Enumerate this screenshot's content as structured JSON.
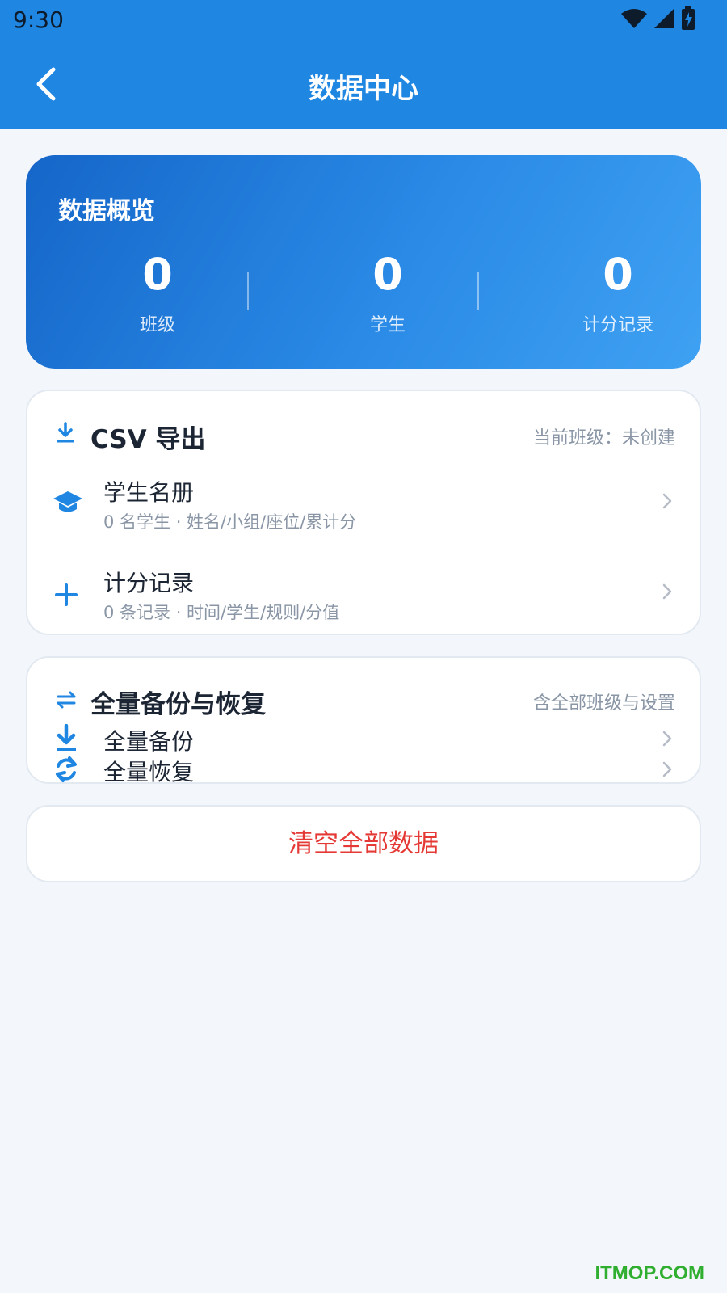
{
  "status_bar": {
    "time": "9:30"
  },
  "header": {
    "title": "数据中心"
  },
  "overview": {
    "title": "数据概览",
    "stats": [
      {
        "value": "0",
        "label": "班级"
      },
      {
        "value": "0",
        "label": "学生"
      },
      {
        "value": "0",
        "label": "计分记录"
      }
    ]
  },
  "csv_export": {
    "title": "CSV 导出",
    "note": "当前班级：未创建",
    "items": [
      {
        "title": "学生名册",
        "subtitle": "0 名学生 · 姓名/小组/座位/累计分",
        "icon": "graduation-cap-icon"
      },
      {
        "title": "计分记录",
        "subtitle": "0 条记录 · 时间/学生/规则/分值",
        "icon": "plus-icon"
      }
    ]
  },
  "backup": {
    "title": "全量备份与恢复",
    "note": "含全部班级与设置",
    "items": [
      {
        "title": "全量备份",
        "icon": "download-icon"
      },
      {
        "title": "全量恢复",
        "icon": "refresh-icon"
      }
    ]
  },
  "clear_button": {
    "label": "清空全部数据"
  },
  "watermark": "ITMOP.COM",
  "colors": {
    "primary": "#1f86e2",
    "danger": "#e53935",
    "background": "#f3f6fb"
  }
}
